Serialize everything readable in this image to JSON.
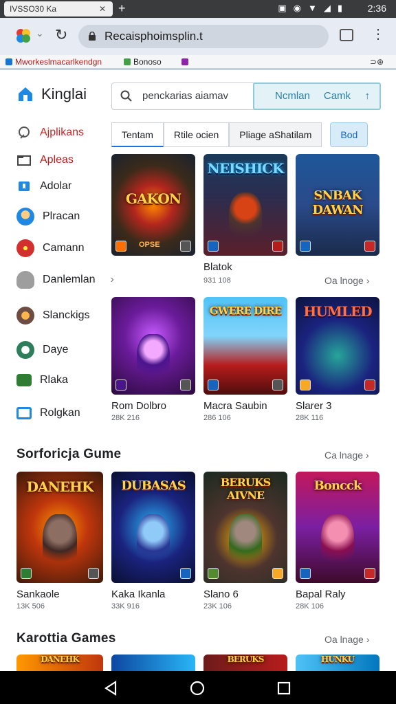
{
  "status": {
    "tab_title": "IVSSO30 Ka",
    "time": "2:36"
  },
  "browser": {
    "url": "Recaisphoimsplin.t"
  },
  "bookmarks": {
    "item1": "Mworkeslmacarlkendgn",
    "item2": "Bonoso",
    "extra": "⊃⊕"
  },
  "app": {
    "title": "Kinglai"
  },
  "search": {
    "placeholder": "penckarias aiamav"
  },
  "cta": {
    "label1": "Ncmlan",
    "label2": "Camk"
  },
  "chips": [
    "Tentam",
    "Rtile ocien",
    "Pliage aShatilam",
    "Bod"
  ],
  "sidebar": [
    {
      "label": "Ajplikans",
      "icon": "info-icon",
      "color": "#c62828"
    },
    {
      "label": "Apleas",
      "icon": "folder-icon",
      "color": "#b71c1c"
    },
    {
      "label": "Adolar",
      "icon": "bookmark-icon",
      "color": "#202124"
    },
    {
      "label": "Plracan",
      "icon": "user-icon",
      "color": "#202124"
    },
    {
      "label": "Camann",
      "icon": "sword-icon",
      "color": "#202124"
    },
    {
      "label": "Danlemlan",
      "icon": "cloud-icon",
      "color": "#202124"
    },
    {
      "label": "Slanckigs",
      "icon": "clock-icon",
      "color": "#202124"
    },
    {
      "label": "Daye",
      "icon": "circle-icon",
      "color": "#202124"
    },
    {
      "label": "Rlaka",
      "icon": "mail-icon",
      "color": "#202124"
    },
    {
      "label": "Rolgkan",
      "icon": "window-icon",
      "color": "#202124"
    }
  ],
  "sidebar_more_arrow": "›",
  "grid": [
    {
      "art_title": "GAKON",
      "bottom_text": "OPSE",
      "name": "",
      "size": ""
    },
    {
      "art_title": "NEISHICK",
      "bottom_text": "",
      "name": "Blatok",
      "size": "931 108"
    },
    {
      "art_title": "SNBAK DAWAN",
      "bottom_text": "",
      "name": "",
      "size": ""
    },
    {
      "art_title": "",
      "bottom_text": "",
      "name": "Rom Dolbro",
      "size": "28K 216"
    },
    {
      "art_title": "GWERE DIRE",
      "bottom_text": "",
      "name": "Macra Saubin",
      "size": "286 106"
    },
    {
      "art_title": "HUMLED",
      "bottom_text": "",
      "name": "Slarer 3",
      "size": "28K 116"
    }
  ],
  "grid_more": "Oa lnoge",
  "section1": {
    "title": "Sorforicja Gume",
    "more": "Ca lnage"
  },
  "section1_items": [
    {
      "art_title": "DANEHK",
      "name": "Sankaole",
      "size": "13K 506"
    },
    {
      "art_title": "DUBASAS",
      "name": "Kaka Ikanla",
      "size": "33K 916"
    },
    {
      "art_title": "BERUKS AIVNE",
      "name": "Slano 6",
      "size": "23K 106"
    },
    {
      "art_title": "Boncck",
      "name": "Bapal Raly",
      "size": "28K 106"
    }
  ],
  "section2": {
    "title": "Karottia Games",
    "more": "Oa lnage"
  },
  "section2_art": [
    "DANEHK",
    "",
    "BERUKS",
    "HUNKU"
  ]
}
